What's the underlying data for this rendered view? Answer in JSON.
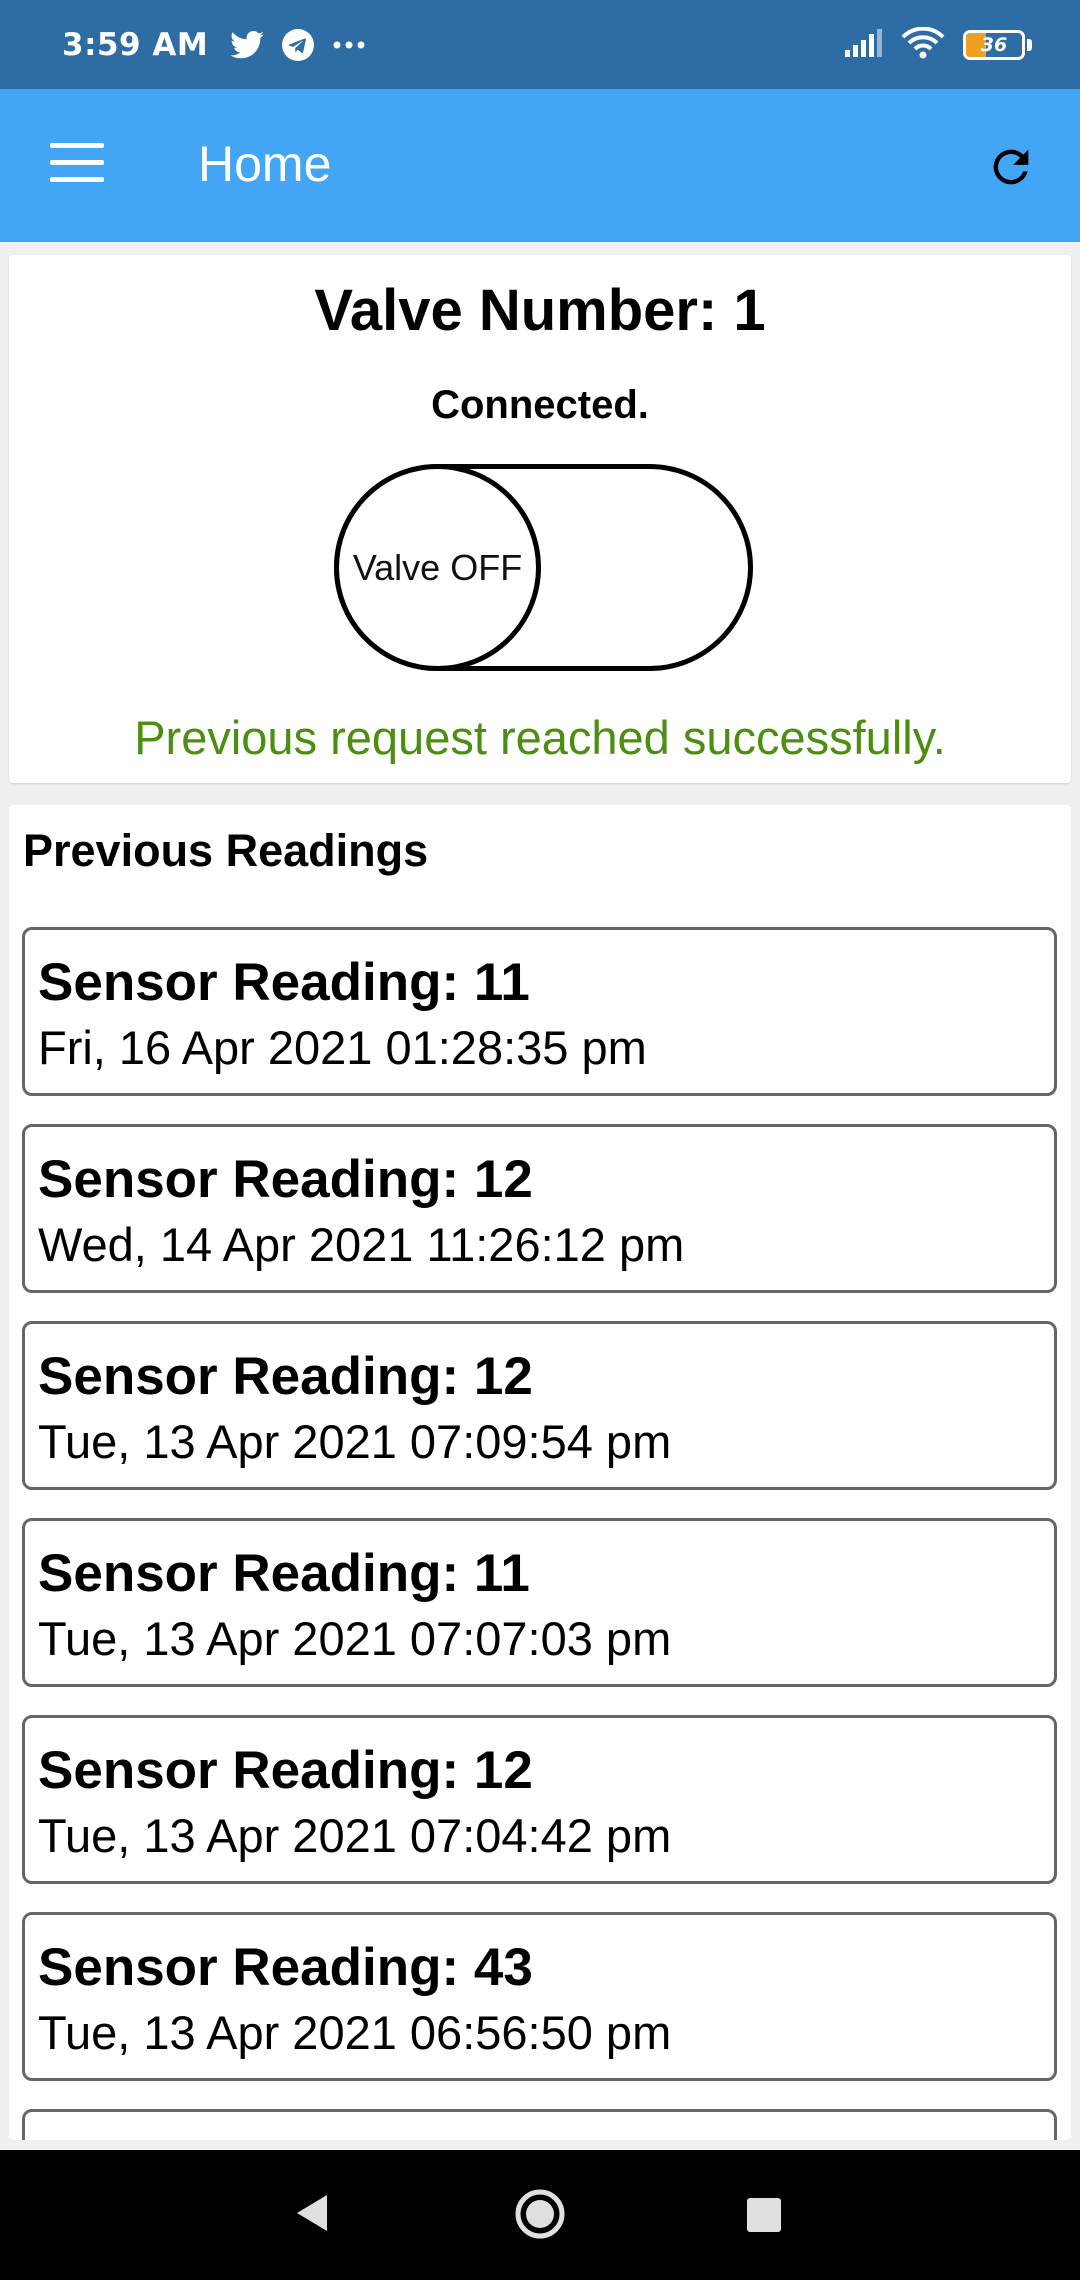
{
  "status_bar": {
    "time": "3:59 AM",
    "notifications": [
      "twitter-icon",
      "telegram-icon",
      "more-icon"
    ],
    "battery_level": "36"
  },
  "app_bar": {
    "title": "Home",
    "menu_icon": "menu-icon",
    "refresh_icon": "refresh-icon",
    "color": "#42a5f5"
  },
  "valve": {
    "title": "Valve Number: 1",
    "connection_status": "Connected.",
    "toggle_label": "Valve OFF",
    "toggle_state": "off",
    "request_message": "Previous request reached successfully.",
    "message_color": "#4c8f10"
  },
  "readings": {
    "title": "Previous Readings",
    "items": [
      {
        "value": "Sensor Reading: 11",
        "time": "Fri, 16 Apr 2021 01:28:35 pm"
      },
      {
        "value": "Sensor Reading: 12",
        "time": "Wed, 14 Apr 2021 11:26:12 pm"
      },
      {
        "value": "Sensor Reading: 12",
        "time": "Tue, 13 Apr 2021 07:09:54 pm"
      },
      {
        "value": "Sensor Reading: 11",
        "time": "Tue, 13 Apr 2021 07:07:03 pm"
      },
      {
        "value": "Sensor Reading: 12",
        "time": "Tue, 13 Apr 2021 07:04:42 pm"
      },
      {
        "value": "Sensor Reading: 43",
        "time": "Tue, 13 Apr 2021 06:56:50 pm"
      },
      {
        "value": "",
        "time": ""
      }
    ]
  },
  "nav_bar": {
    "buttons": [
      "back-icon",
      "home-icon",
      "recents-icon"
    ]
  }
}
